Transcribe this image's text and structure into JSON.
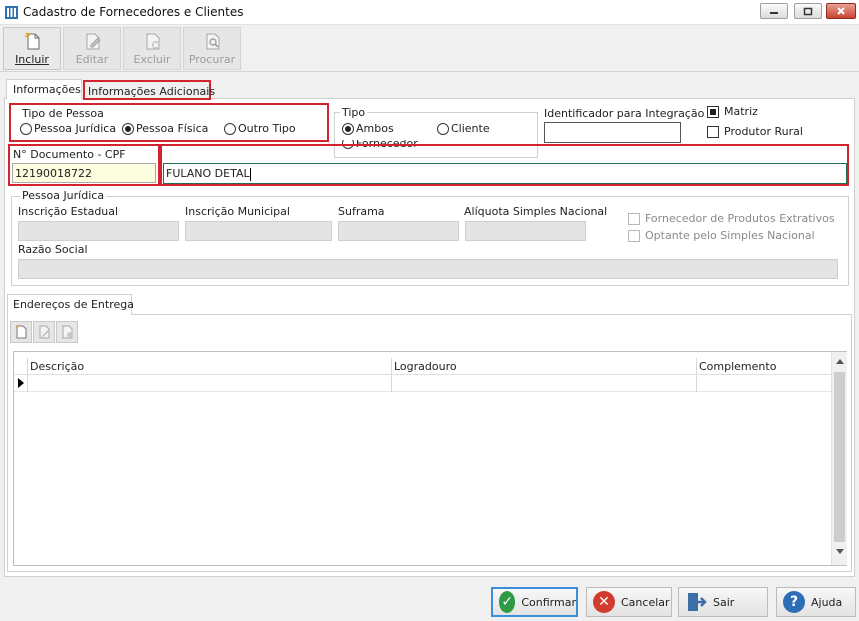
{
  "window": {
    "title": "Cadastro de Fornecedores e Clientes"
  },
  "toolbar": {
    "incluir": "Incluir",
    "editar": "Editar",
    "excluir": "Excluir",
    "procurar": "Procurar"
  },
  "tabs": {
    "informacoes": "Informações",
    "adicionais": "Informações Adicionais"
  },
  "tipo_pessoa": {
    "legend": "Tipo de Pessoa",
    "options": [
      "Pessoa Jurídica",
      "Pessoa Física",
      "Outro Tipo"
    ],
    "selected": "Pessoa Física"
  },
  "tipo": {
    "legend": "Tipo",
    "options": [
      "Ambos",
      "Cliente",
      "Fornecedor"
    ],
    "selected": "Ambos"
  },
  "integracao": {
    "label": "Identificador para Integração",
    "value": ""
  },
  "flags": {
    "matriz": "Matriz",
    "produtor_rural": "Produtor Rural"
  },
  "documento": {
    "label": "N° Documento - CPF",
    "value": "12190018722",
    "nome": "FULANO DETAL"
  },
  "pessoa_juridica": {
    "legend": "Pessoa Jurídica",
    "inscricao_estadual": "Inscrição Estadual",
    "inscricao_municipal": "Inscrição Municipal",
    "suframa": "Suframa",
    "aliquota": "Alíquota Simples Nacional",
    "razao_social": "Razão Social",
    "fornecedor_extrativos": "Fornecedor de Produtos Extrativos",
    "optante_simples": "Optante pelo Simples Nacional"
  },
  "enderecos": {
    "tab": "Endereços de Entrega",
    "columns": [
      "Descrição",
      "Logradouro",
      "Complemento"
    ]
  },
  "buttons": {
    "confirmar": "Confirmar",
    "cancelar": "Cancelar",
    "sair": "Sair",
    "ajuda": "Ajuda"
  }
}
